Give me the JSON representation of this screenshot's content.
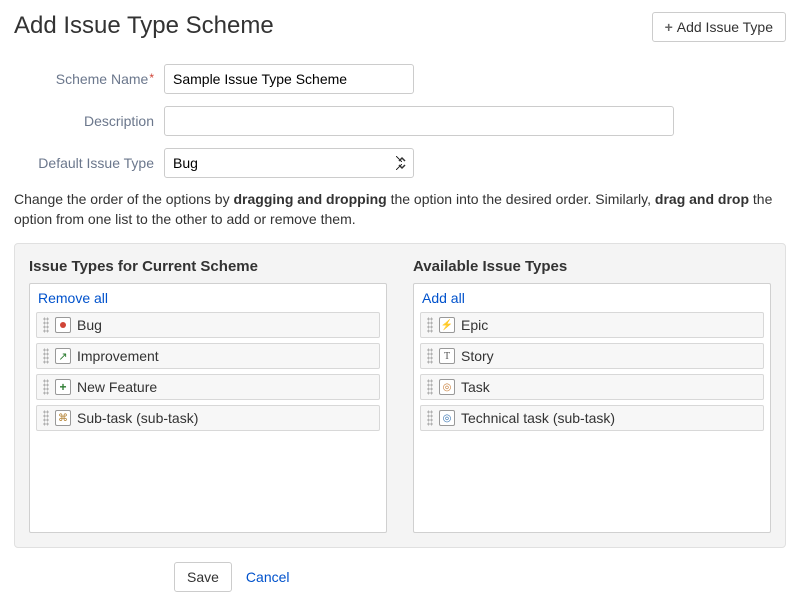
{
  "header": {
    "title": "Add Issue Type Scheme",
    "add_button_label": "Add Issue Type"
  },
  "form": {
    "scheme_name_label": "Scheme Name",
    "scheme_name_value": "Sample Issue Type Scheme",
    "description_label": "Description",
    "description_value": "",
    "default_type_label": "Default Issue Type",
    "default_type_value": "Bug"
  },
  "instructions": {
    "p1": "Change the order of the options by ",
    "b1": "dragging and dropping",
    "p2": " the option into the desired order. Similarly, ",
    "b2": "drag and drop",
    "p3": " the option from one list to the other to add or remove them."
  },
  "current_list": {
    "title": "Issue Types for Current Scheme",
    "bulk_link": "Remove all",
    "items": [
      {
        "label": "Bug",
        "icon": "bug"
      },
      {
        "label": "Improvement",
        "icon": "improvement"
      },
      {
        "label": "New Feature",
        "icon": "newfeature"
      },
      {
        "label": "Sub-task (sub-task)",
        "icon": "subtask"
      }
    ]
  },
  "available_list": {
    "title": "Available Issue Types",
    "bulk_link": "Add all",
    "items": [
      {
        "label": "Epic",
        "icon": "epic"
      },
      {
        "label": "Story",
        "icon": "story"
      },
      {
        "label": "Task",
        "icon": "task"
      },
      {
        "label": "Technical task (sub-task)",
        "icon": "techtask"
      }
    ]
  },
  "footer": {
    "save_label": "Save",
    "cancel_label": "Cancel"
  }
}
